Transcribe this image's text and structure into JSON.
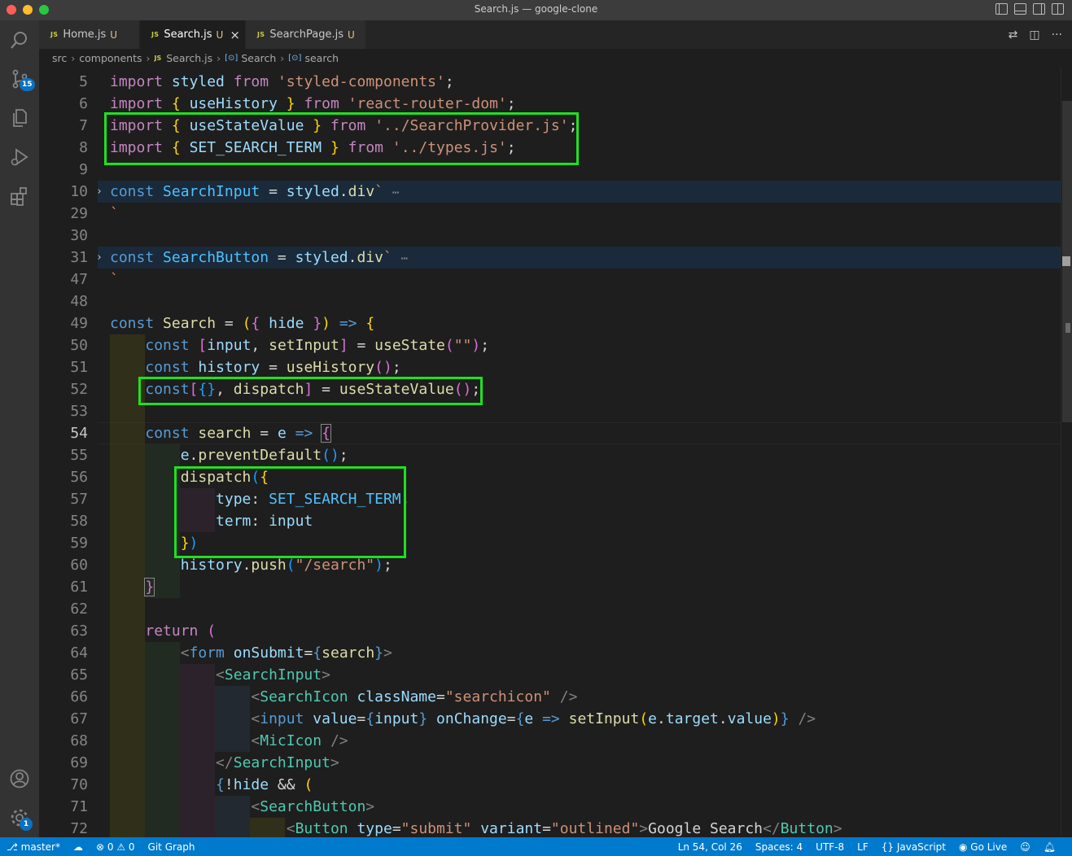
{
  "window": {
    "title": "Search.js — google-clone"
  },
  "activity": {
    "source_control_badge": "15",
    "settings_badge": "1"
  },
  "tabs": [
    {
      "label": "Home.js",
      "status": "U",
      "active": false
    },
    {
      "label": "Search.js",
      "status": "U",
      "active": true
    },
    {
      "label": "SearchPage.js",
      "status": "U",
      "active": false
    }
  ],
  "breadcrumb": {
    "parts": [
      "src",
      "components",
      "Search.js",
      "Search",
      "search"
    ]
  },
  "editor": {
    "line_numbers": [
      "5",
      "6",
      "7",
      "8",
      "9",
      "10",
      "29",
      "30",
      "31",
      "47",
      "48",
      "49",
      "50",
      "51",
      "52",
      "53",
      "54",
      "55",
      "56",
      "57",
      "58",
      "59",
      "60",
      "61",
      "62",
      "63",
      "64",
      "65",
      "66",
      "67",
      "68",
      "69",
      "70",
      "71",
      "72"
    ],
    "active_line": "54"
  },
  "statusbar": {
    "branch": "master*",
    "errors": "0",
    "warnings": "0",
    "git_graph": "Git Graph",
    "position": "Ln 54, Col 26",
    "spaces": "Spaces: 4",
    "encoding": "UTF-8",
    "eol": "LF",
    "language": "JavaScript",
    "golive": "Go Live"
  },
  "colors": {
    "accent": "#007acc",
    "highlight_box": "#1fe01f"
  }
}
